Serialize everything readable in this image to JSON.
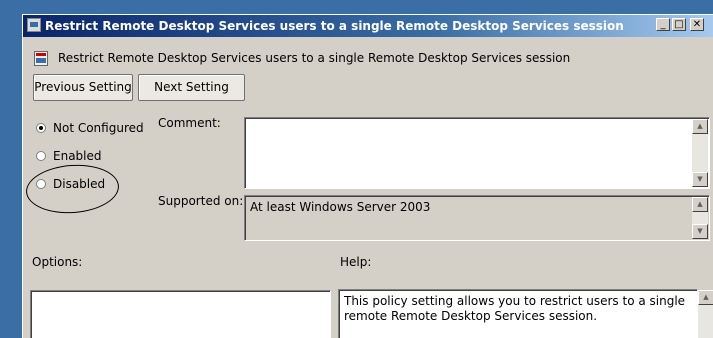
{
  "window": {
    "title": "Restrict Remote Desktop Services users to a single Remote Desktop Services session",
    "controls": {
      "minimize": "_",
      "maximize": "□",
      "close": "✕"
    }
  },
  "header": {
    "text": "Restrict Remote Desktop Services users to a single Remote Desktop Services session",
    "icon": "policy-setting-icon"
  },
  "nav": {
    "previous_label": "Previous Setting",
    "next_label": "Next Setting"
  },
  "state": {
    "options": [
      {
        "label": "Not Configured",
        "selected": true
      },
      {
        "label": "Enabled",
        "selected": false
      },
      {
        "label": "Disabled",
        "selected": false
      }
    ],
    "annotation": "hand-drawn circle around Disabled"
  },
  "comment": {
    "label": "Comment:",
    "value": ""
  },
  "supported": {
    "label": "Supported on:",
    "value": "At least Windows Server 2003"
  },
  "options_label": "Options:",
  "help": {
    "label": "Help:",
    "text": "This policy setting allows you to restrict users to a single remote Remote Desktop Services session."
  },
  "colors": {
    "desktop": "#3a6ea5",
    "titlebar_start": "#0a246a",
    "dialog_face": "#d4d0c8"
  }
}
